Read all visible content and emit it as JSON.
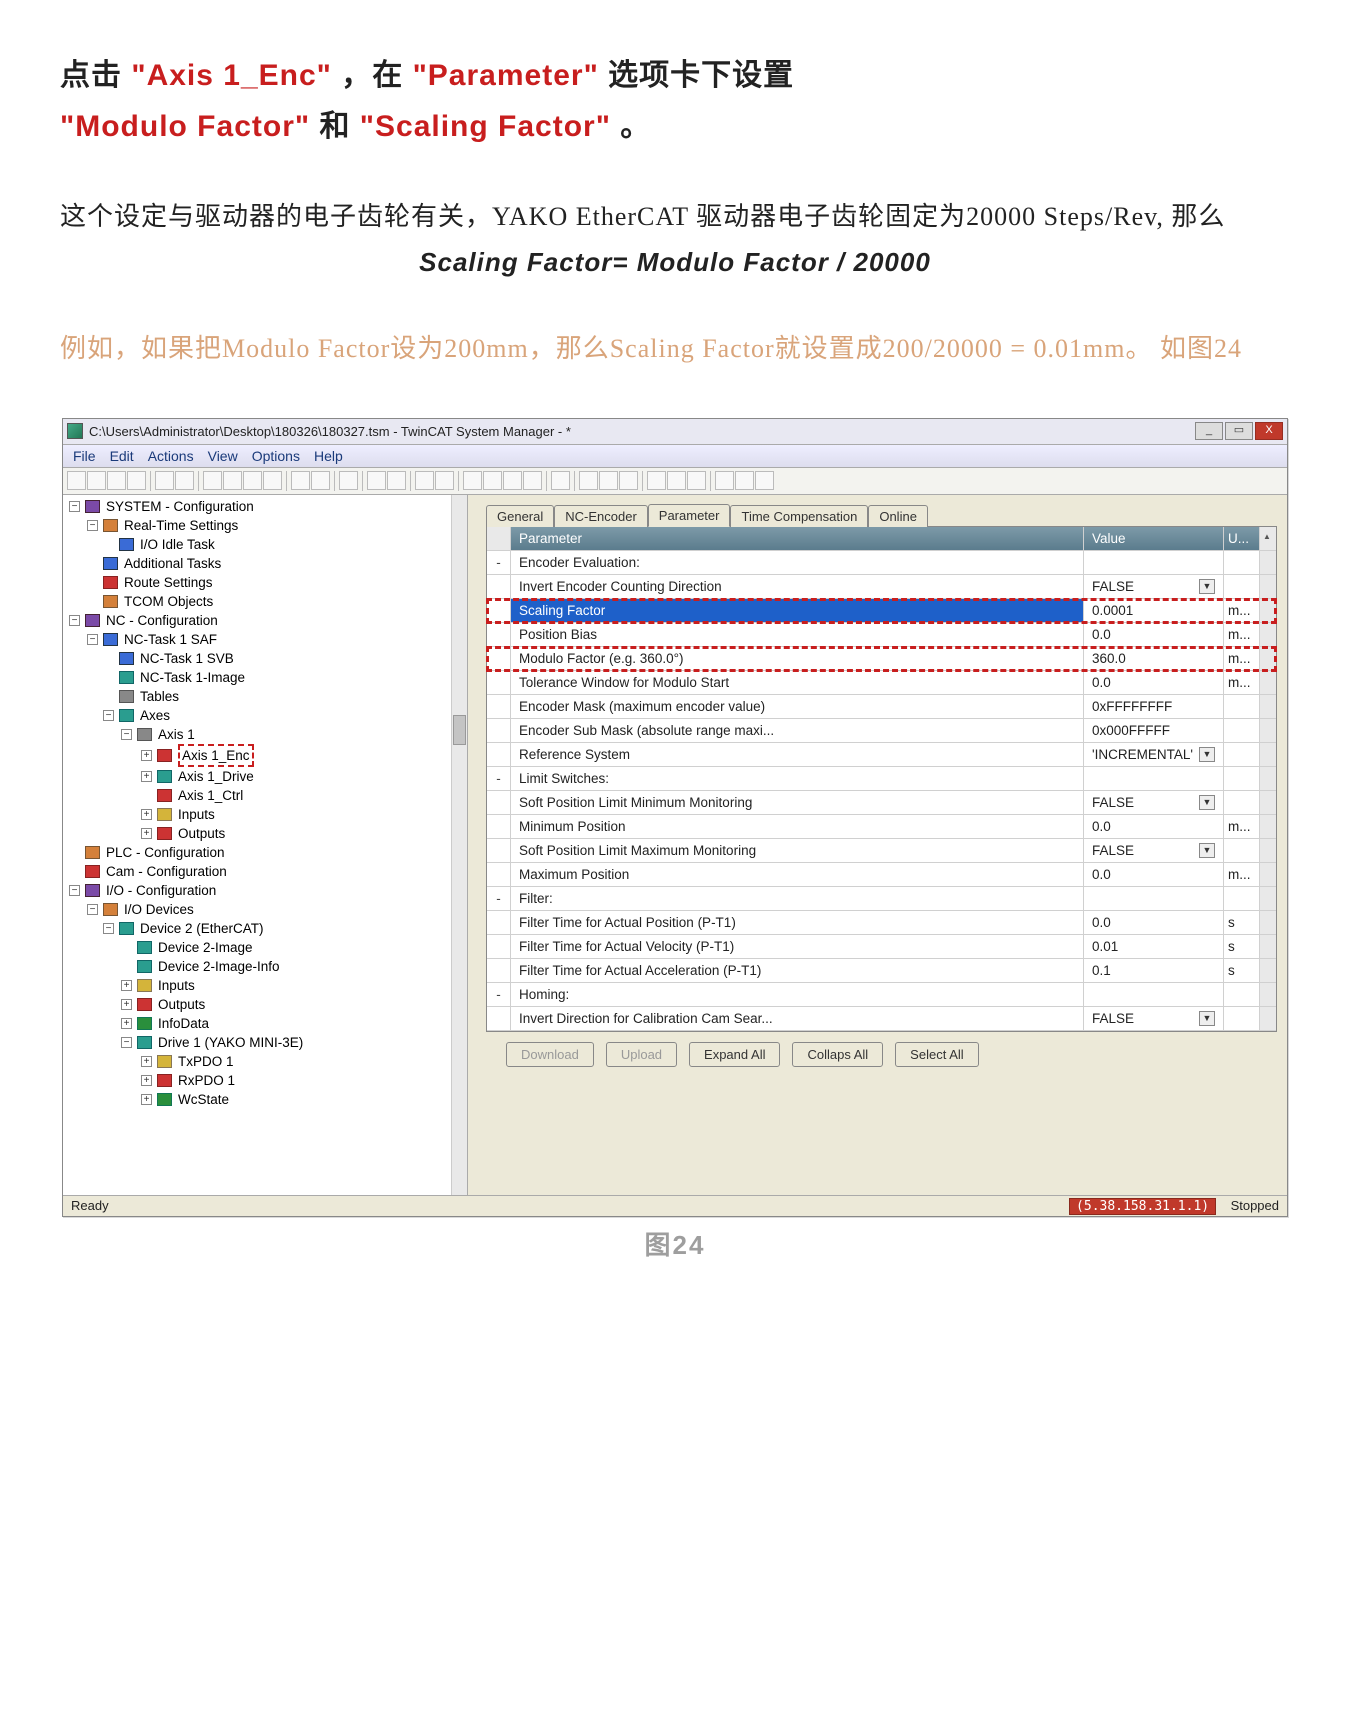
{
  "heading": {
    "p1a": "点击",
    "p1b": "\"Axis 1_Enc\"",
    "p1c": "，在",
    "p1d": "\"Parameter\"",
    "p1e": " 选项卡下设置",
    "p2a": "\"Modulo Factor\"",
    "p2b": "和",
    "p2c": "\"Scaling Factor\"",
    "p2d": "。"
  },
  "body": {
    "line1": "这个设定与驱动器的电子齿轮有关，YAKO EtherCAT 驱动器电子齿轮固定为20000 Steps/Rev, 那么",
    "formula": "Scaling Factor= Modulo Factor / 20000"
  },
  "example": {
    "line": "例如，如果把Modulo Factor设为200mm，那么Scaling Factor就设置成200/20000 = 0.01mm。 如图24"
  },
  "caption": "图24",
  "window": {
    "title": "C:\\Users\\Administrator\\Desktop\\180326\\180327.tsm - TwinCAT System Manager - *",
    "min": "_",
    "max": "▭",
    "close": "X"
  },
  "menu": [
    "File",
    "Edit",
    "Actions",
    "View",
    "Options",
    "Help"
  ],
  "tree": [
    {
      "ind": 0,
      "exp": "−",
      "ico": "purple",
      "t": "SYSTEM - Configuration"
    },
    {
      "ind": 1,
      "exp": "−",
      "ico": "orange",
      "t": "Real-Time Settings"
    },
    {
      "ind": 2,
      "exp": "",
      "ico": "blue",
      "t": "I/O Idle Task"
    },
    {
      "ind": 1,
      "exp": "",
      "ico": "blue",
      "t": "Additional Tasks"
    },
    {
      "ind": 1,
      "exp": "",
      "ico": "red",
      "t": "Route Settings"
    },
    {
      "ind": 1,
      "exp": "",
      "ico": "orange",
      "t": "TCOM Objects"
    },
    {
      "ind": 0,
      "exp": "−",
      "ico": "purple",
      "t": "NC - Configuration"
    },
    {
      "ind": 1,
      "exp": "−",
      "ico": "blue",
      "t": "NC-Task 1 SAF"
    },
    {
      "ind": 2,
      "exp": "",
      "ico": "blue",
      "t": "NC-Task 1 SVB"
    },
    {
      "ind": 2,
      "exp": "",
      "ico": "teal",
      "t": "NC-Task 1-Image"
    },
    {
      "ind": 2,
      "exp": "",
      "ico": "gray",
      "t": "Tables"
    },
    {
      "ind": 2,
      "exp": "−",
      "ico": "teal",
      "t": "Axes"
    },
    {
      "ind": 3,
      "exp": "−",
      "ico": "gray",
      "t": "Axis 1"
    },
    {
      "ind": 4,
      "exp": "+",
      "ico": "red",
      "t": "Axis 1_Enc",
      "hi": true
    },
    {
      "ind": 4,
      "exp": "+",
      "ico": "teal",
      "t": "Axis 1_Drive"
    },
    {
      "ind": 4,
      "exp": "",
      "ico": "red",
      "t": "Axis 1_Ctrl"
    },
    {
      "ind": 4,
      "exp": "+",
      "ico": "yellow",
      "t": "Inputs"
    },
    {
      "ind": 4,
      "exp": "+",
      "ico": "red",
      "t": "Outputs"
    },
    {
      "ind": 0,
      "exp": "",
      "ico": "orange",
      "t": "PLC - Configuration"
    },
    {
      "ind": 0,
      "exp": "",
      "ico": "red",
      "t": "Cam - Configuration"
    },
    {
      "ind": 0,
      "exp": "−",
      "ico": "purple",
      "t": "I/O - Configuration"
    },
    {
      "ind": 1,
      "exp": "−",
      "ico": "orange",
      "t": "I/O Devices"
    },
    {
      "ind": 2,
      "exp": "−",
      "ico": "teal",
      "t": "Device 2 (EtherCAT)"
    },
    {
      "ind": 3,
      "exp": "",
      "ico": "teal",
      "t": "Device 2-Image"
    },
    {
      "ind": 3,
      "exp": "",
      "ico": "teal",
      "t": "Device 2-Image-Info"
    },
    {
      "ind": 3,
      "exp": "+",
      "ico": "yellow",
      "t": "Inputs"
    },
    {
      "ind": 3,
      "exp": "+",
      "ico": "red",
      "t": "Outputs"
    },
    {
      "ind": 3,
      "exp": "+",
      "ico": "green",
      "t": "InfoData"
    },
    {
      "ind": 3,
      "exp": "−",
      "ico": "teal",
      "t": "Drive 1 (YAKO MINI-3E)"
    },
    {
      "ind": 4,
      "exp": "+",
      "ico": "yellow",
      "t": "TxPDO 1"
    },
    {
      "ind": 4,
      "exp": "+",
      "ico": "red",
      "t": "RxPDO 1"
    },
    {
      "ind": 4,
      "exp": "+",
      "ico": "green",
      "t": "WcState"
    }
  ],
  "tabs": [
    "General",
    "NC-Encoder",
    "Parameter",
    "Time Compensation",
    "Online"
  ],
  "activeTab": 2,
  "grid": {
    "headParam": "Parameter",
    "headValue": "Value",
    "headUnit": "U...",
    "rows": [
      {
        "plus": "-",
        "p": "Encoder Evaluation:",
        "v": "",
        "u": "",
        "bold": true
      },
      {
        "plus": "",
        "p": "Invert Encoder Counting Direction",
        "v": "FALSE",
        "u": "",
        "dd": true
      },
      {
        "plus": "",
        "p": "Scaling Factor",
        "v": "0.0001",
        "u": "m...",
        "sel": true,
        "redbox": true
      },
      {
        "plus": "",
        "p": "Position Bias",
        "v": "0.0",
        "u": "m..."
      },
      {
        "plus": "",
        "p": "Modulo Factor (e.g. 360.0°)",
        "v": "360.0",
        "u": "m...",
        "redbox": true
      },
      {
        "plus": "",
        "p": "   Tolerance Window for Modulo Start",
        "v": "0.0",
        "u": "m..."
      },
      {
        "plus": "",
        "p": "Encoder Mask (maximum encoder value)",
        "v": "0xFFFFFFFF",
        "u": ""
      },
      {
        "plus": "",
        "p": "Encoder Sub Mask (absolute range maxi...",
        "v": "0x000FFFFF",
        "u": ""
      },
      {
        "plus": "",
        "p": "Reference System",
        "v": "'INCREMENTAL'",
        "u": "",
        "dd": true
      },
      {
        "plus": "-",
        "p": "Limit Switches:",
        "v": "",
        "u": "",
        "bold": true
      },
      {
        "plus": "",
        "p": "Soft Position Limit Minimum Monitoring",
        "v": "FALSE",
        "u": "",
        "dd": true
      },
      {
        "plus": "",
        "p": "   Minimum Position",
        "v": "0.0",
        "u": "m..."
      },
      {
        "plus": "",
        "p": "Soft Position Limit Maximum Monitoring",
        "v": "FALSE",
        "u": "",
        "dd": true
      },
      {
        "plus": "",
        "p": "   Maximum Position",
        "v": "0.0",
        "u": "m..."
      },
      {
        "plus": "-",
        "p": "Filter:",
        "v": "",
        "u": "",
        "bold": true
      },
      {
        "plus": "",
        "p": "Filter Time for Actual Position (P-T1)",
        "v": "0.0",
        "u": "s"
      },
      {
        "plus": "",
        "p": "Filter Time for Actual Velocity (P-T1)",
        "v": "0.01",
        "u": "s"
      },
      {
        "plus": "",
        "p": "Filter Time for Actual Acceleration (P-T1)",
        "v": "0.1",
        "u": "s"
      },
      {
        "plus": "-",
        "p": "Homing:",
        "v": "",
        "u": "",
        "bold": true
      },
      {
        "plus": "",
        "p": "Invert Direction for Calibration Cam Sear...",
        "v": "FALSE",
        "u": "",
        "dd": true
      }
    ]
  },
  "buttons": {
    "download": "Download",
    "upload": "Upload",
    "expand": "Expand All",
    "collapse": "Collaps All",
    "select": "Select All"
  },
  "status": {
    "ready": "Ready",
    "ip": "(5.38.158.31.1.1)",
    "state": "Stopped"
  }
}
